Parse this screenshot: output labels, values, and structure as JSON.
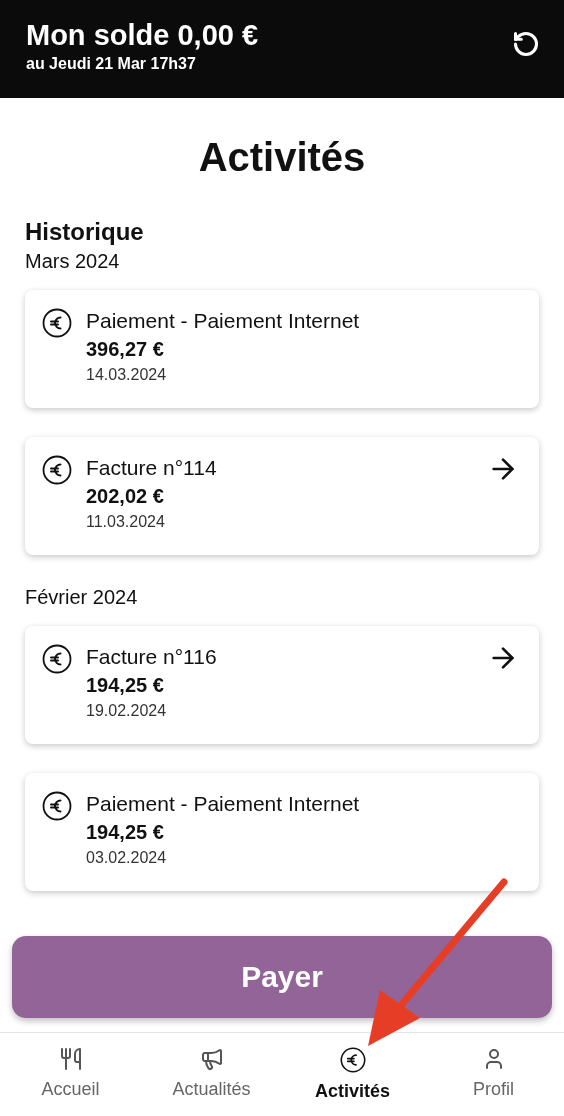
{
  "header": {
    "title": "Mon solde 0,00 €",
    "subtitle": "au Jeudi 21 Mar 17h37"
  },
  "page_title": "Activités",
  "section_title": "Historique",
  "groups": [
    {
      "label": "Mars 2024",
      "items": [
        {
          "title": "Paiement - Paiement Internet",
          "amount": "396,27 €",
          "date": "14.03.2024",
          "link": false
        },
        {
          "title": "Facture n°114",
          "amount": "202,02 €",
          "date": "11.03.2024",
          "link": true
        }
      ]
    },
    {
      "label": "Février 2024",
      "items": [
        {
          "title": "Facture n°116",
          "amount": "194,25 €",
          "date": "19.02.2024",
          "link": true
        },
        {
          "title": "Paiement - Paiement Internet",
          "amount": "194,25 €",
          "date": "03.02.2024",
          "link": false
        }
      ]
    }
  ],
  "pay_button": "Payer",
  "nav": [
    {
      "kind": "home",
      "label": "Accueil",
      "selected": false
    },
    {
      "kind": "news",
      "label": "Actualités",
      "selected": false
    },
    {
      "kind": "activity",
      "label": "Activités",
      "selected": true
    },
    {
      "kind": "profile",
      "label": "Profil",
      "selected": false
    }
  ]
}
